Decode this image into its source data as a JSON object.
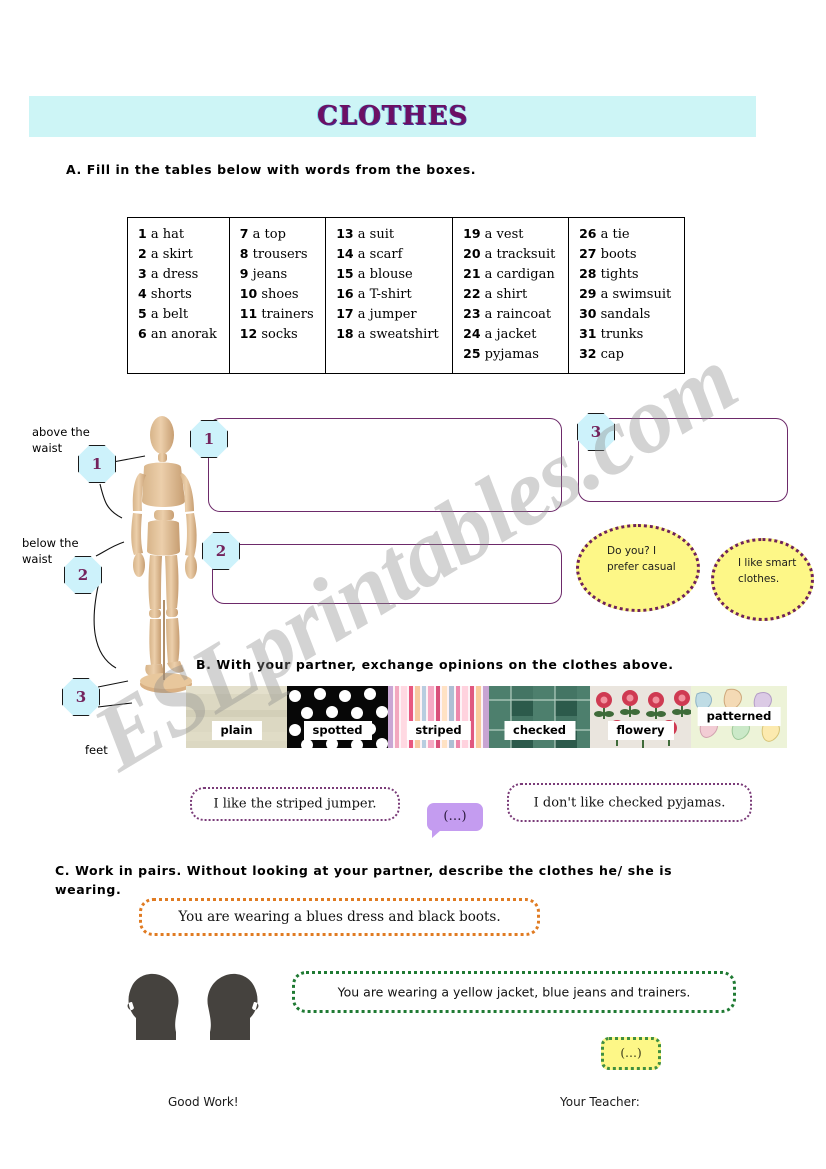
{
  "watermark": {
    "text": "ESLprintables.com"
  },
  "header": {
    "title": "CLOTHES",
    "banner_color": "#cdf5f6",
    "title_color": "#6d0f63"
  },
  "instructions": {
    "a": "A. Fill in the tables below with words from the boxes.",
    "b": "B. With your partner, exchange opinions on the clothes above.",
    "c": "C. Work in pairs. Without looking at your partner, describe the clothes he/ she   is wearing."
  },
  "word_table": {
    "columns": [
      [
        "1 a hat",
        "2 a skirt",
        "3 a dress",
        "4 shorts",
        "5 a belt",
        "6 an anorak"
      ],
      [
        "7 a top",
        "8 trousers",
        "9 jeans",
        "10 shoes",
        "11 trainers",
        "12 socks"
      ],
      [
        "13 a suit",
        "14 a scarf",
        "15 a blouse",
        "16 a T-shirt",
        "17 a jumper",
        "18 a sweatshirt"
      ],
      [
        "19 a vest",
        "20 a tracksuit",
        "21 a cardigan",
        "22 a shirt",
        "23 a raincoat",
        "24 a jacket",
        "25 pyjamas"
      ],
      [
        "26 a tie",
        "27 boots",
        "28 tights",
        "29 a swimsuit",
        "30 sandals",
        "31 trunks",
        "32 cap"
      ]
    ],
    "numbers": [
      [
        "1",
        "2",
        "3",
        "4",
        "5",
        "6"
      ],
      [
        "7",
        "8",
        "9",
        "10",
        "11",
        "12"
      ],
      [
        "13",
        "14",
        "15",
        "16",
        "17",
        "18"
      ],
      [
        "19",
        "20",
        "21",
        "22",
        "23",
        "24",
        "25"
      ],
      [
        "26",
        "27",
        "28",
        "29",
        "30",
        "31",
        "32"
      ]
    ],
    "words": [
      [
        "a hat",
        "a skirt",
        "a dress",
        "shorts",
        "a belt",
        "an anorak"
      ],
      [
        "a top",
        "trousers",
        "jeans",
        "shoes",
        "trainers",
        "socks"
      ],
      [
        "a suit",
        "a scarf",
        "a blouse",
        "a T-shirt",
        "a jumper",
        "a sweatshirt"
      ],
      [
        "a vest",
        "a tracksuit",
        "a cardigan",
        "a shirt",
        "a raincoat",
        "a jacket",
        "pyjamas"
      ],
      [
        "a tie",
        "boots",
        "tights",
        "a swimsuit",
        "sandals",
        "trunks",
        "cap"
      ]
    ]
  },
  "body_labels": {
    "above_waist": "above the waist",
    "below_waist": "below the waist",
    "feet": "feet"
  },
  "badges": {
    "body_1": "1",
    "body_2": "2",
    "body_3": "3",
    "box_1": "1",
    "box_2": "2",
    "box_3": "3"
  },
  "answer_boxes": {
    "box_1_value": "",
    "box_2_value": "",
    "box_3_value": ""
  },
  "opinion_bubbles": {
    "casual": "Do you? I prefer casual",
    "smart": "I like smart clothes."
  },
  "patterns": {
    "items": [
      {
        "label": "plain"
      },
      {
        "label": "spotted"
      },
      {
        "label": "striped"
      },
      {
        "label": "checked"
      },
      {
        "label": "flowery"
      },
      {
        "label": "patterned"
      }
    ]
  },
  "pattern_bubbles": {
    "like": "I like the striped jumper.",
    "dots": "(…)",
    "dislike": "I don't like checked pyjamas."
  },
  "describe_bubbles": {
    "orange": "You are wearing a blues dress and black boots.",
    "green": "You are wearing a yellow jacket, blue jeans and trainers.",
    "final": "(…)"
  },
  "footer": {
    "good_work": "Good Work!",
    "teacher": "Your Teacher:"
  }
}
